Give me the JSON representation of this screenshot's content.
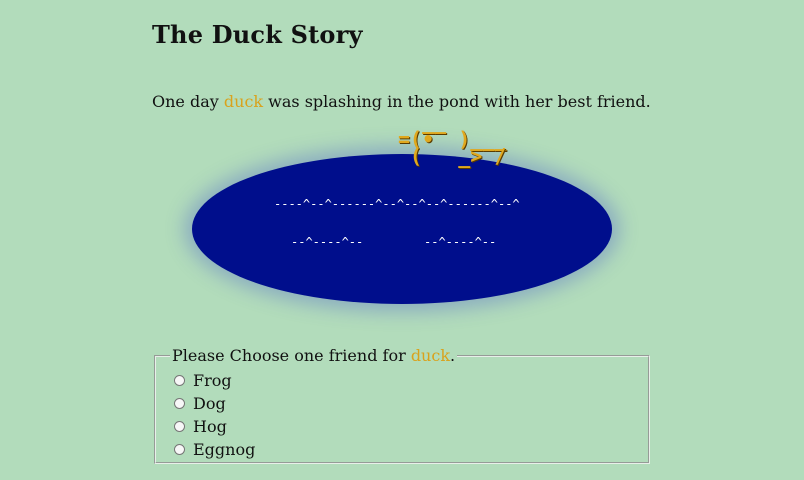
{
  "page": {
    "title": "The Duck Story"
  },
  "story": {
    "prefix": "One day ",
    "name": "duck",
    "suffix": " was splashing in the pond with her best friend."
  },
  "pond": {
    "ripple_line_1": "----^--^------^--^--^--^------^--^",
    "ripple_line_2": "--^----^--",
    "ripple_line_3": "--^----^--",
    "duck_ascii": "  __\n=(•  )___\n (   _> /",
    "water_color": "#000e8c",
    "duck_color": "#e0a81e"
  },
  "friend_form": {
    "legend_prefix": "Please Choose one friend for ",
    "legend_name": "duck",
    "legend_suffix": ".",
    "options": [
      "Frog",
      "Dog",
      "Hog",
      "Eggnog"
    ]
  },
  "colors": {
    "background": "#b2dcbb",
    "highlight": "#d9a21c"
  }
}
